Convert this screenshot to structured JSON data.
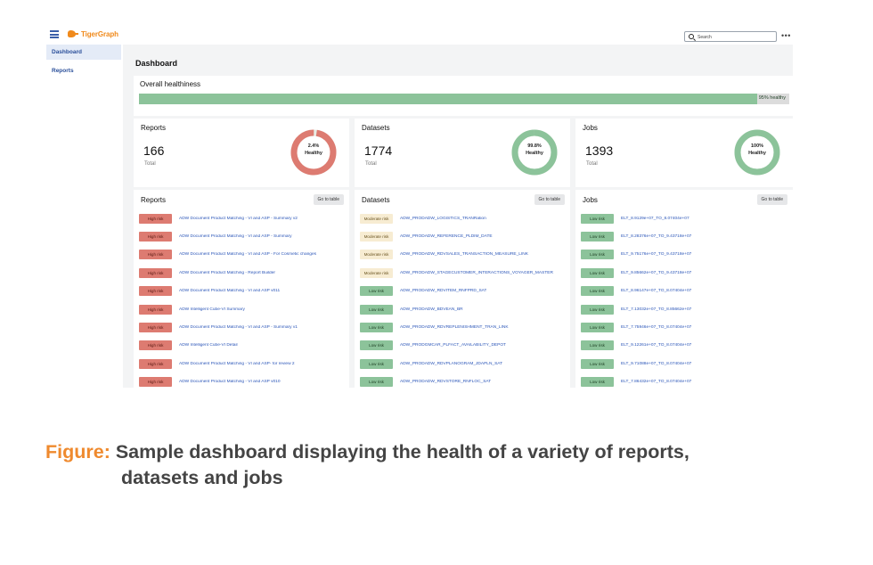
{
  "app": {
    "logo_text": "TigerGraph"
  },
  "search": {
    "placeholder": "Search"
  },
  "more_glyph": "•••",
  "sidebar": {
    "items": [
      {
        "label": "Dashboard",
        "active": true
      },
      {
        "label": "Reports",
        "active": false
      }
    ]
  },
  "page": {
    "title": "Dashboard"
  },
  "overall": {
    "label": "Overall healthiness",
    "percent": 95,
    "text": "95% healthy",
    "color": "#8cc39a"
  },
  "summary": [
    {
      "title": "Reports",
      "value": "166",
      "total_label": "Total",
      "healthy_pct": 2.4,
      "donut_pct": "2.4%",
      "donut_word": "Healthy",
      "ring_color": "#dd7b71"
    },
    {
      "title": "Datasets",
      "value": "1774",
      "total_label": "Total",
      "healthy_pct": 99.8,
      "donut_pct": "99.8%",
      "donut_word": "Healthy",
      "ring_color": "#8cc39a"
    },
    {
      "title": "Jobs",
      "value": "1393",
      "total_label": "Total",
      "healthy_pct": 100,
      "donut_pct": "100%",
      "donut_word": "Healthy",
      "ring_color": "#8cc39a"
    }
  ],
  "lists": [
    {
      "title": "Reports",
      "button": "Go to table",
      "rows": [
        {
          "risk": "High risk",
          "level": "high",
          "name": "ADW Document Product Matching - VI and ASP - Summary v2"
        },
        {
          "risk": "High risk",
          "level": "high",
          "name": "ADW Document Product Matching - VI and ASP - Summary"
        },
        {
          "risk": "High risk",
          "level": "high",
          "name": "ADW Document Product Matching - VI and ASP - For Cosmetic changes"
        },
        {
          "risk": "High risk",
          "level": "high",
          "name": "ADW Document Product Matching - Report Builder"
        },
        {
          "risk": "High risk",
          "level": "high",
          "name": "ADW Document Product Matching - VI and ASP v011"
        },
        {
          "risk": "High risk",
          "level": "high",
          "name": "ADW Intelligent Cube-VI Summary"
        },
        {
          "risk": "High risk",
          "level": "high",
          "name": "ADW Document Product Matching - VI and ASP - Summary v1"
        },
        {
          "risk": "High risk",
          "level": "high",
          "name": "ADW Intelligent Cube-VI Detail"
        },
        {
          "risk": "High risk",
          "level": "high",
          "name": "ADW Document Product Matching - VI and ASP- for review 2"
        },
        {
          "risk": "High risk",
          "level": "high",
          "name": "ADW Document Product Matching - VI and ASP v010"
        }
      ]
    },
    {
      "title": "Datasets",
      "button": "Go to table",
      "rows": [
        {
          "risk": "Moderate risk",
          "level": "moderate",
          "name": "ADW_PRODADW_LOGISTICS_TRANRation"
        },
        {
          "risk": "Moderate risk",
          "level": "moderate",
          "name": "ADW_PRODADW_REFERENCE_PLDIM_DATE"
        },
        {
          "risk": "Moderate risk",
          "level": "moderate",
          "name": "ADW_PRODADW_RDVSALES_TRANSACTION_MEASURE_LINK"
        },
        {
          "risk": "Moderate risk",
          "level": "moderate",
          "name": "ADW_PRODADW_STAGECUSTOMER_INTERACTIONS_VOYAGER_MASTER"
        },
        {
          "risk": "Low risk",
          "level": "low",
          "name": "ADW_PRODADW_RDVITEM_RNFPRD_SAT"
        },
        {
          "risk": "Low risk",
          "level": "low",
          "name": "ADW_PRODADW_BDVEAN_BR"
        },
        {
          "risk": "Low risk",
          "level": "low",
          "name": "ADW_PRODADW_RDVREPLENISHMENT_TRAN_LINK"
        },
        {
          "risk": "Low risk",
          "level": "low",
          "name": "ADW_PRODGMCAR_PLFACT_AVAILABILITY_DEPOT"
        },
        {
          "risk": "Low risk",
          "level": "low",
          "name": "ADW_PRODADW_RDVPLANOGRAM_JDAPLN_SAT"
        },
        {
          "risk": "Low risk",
          "level": "low",
          "name": "ADW_PRODADW_RDVSTORE_RNFLOC_SAT"
        }
      ]
    },
    {
      "title": "Jobs",
      "button": "Go to table",
      "rows": [
        {
          "risk": "Low risk",
          "level": "low",
          "name": "ELT_8.9129e+07_TO_8.07404e+07"
        },
        {
          "risk": "Low risk",
          "level": "low",
          "name": "ELT_8.28376e+07_TO_9.43718e+07"
        },
        {
          "risk": "Low risk",
          "level": "low",
          "name": "ELT_9.75176e+07_TO_9.43718e+07"
        },
        {
          "risk": "Low risk",
          "level": "low",
          "name": "ELT_9.85662e+07_TO_9.43718e+07"
        },
        {
          "risk": "Low risk",
          "level": "low",
          "name": "ELT_8.96147e+07_TO_8.07404e+07"
        },
        {
          "risk": "Low risk",
          "level": "low",
          "name": "ELT_7.13032e+07_TO_8.85662e+07"
        },
        {
          "risk": "Low risk",
          "level": "low",
          "name": "ELT_7.75946e+07_TO_8.07404e+07"
        },
        {
          "risk": "Low risk",
          "level": "low",
          "name": "ELT_9.12261e+07_TO_8.07404e+07"
        },
        {
          "risk": "Low risk",
          "level": "low",
          "name": "ELT_9.71088e+07_TO_8.07404e+07"
        },
        {
          "risk": "Low risk",
          "level": "low",
          "name": "ELT_7.86432e+07_TO_8.07404e+07"
        }
      ]
    }
  ],
  "caption": {
    "prefix": "Figure:",
    "line1": "Sample dashboard displaying the health of a variety of reports,",
    "line2": "datasets and jobs"
  },
  "colors": {
    "high": "#dd7b71",
    "moderate": "#f7ecd2",
    "low": "#8cc39a",
    "link": "#2a55b8",
    "brand": "#f08a1c"
  }
}
